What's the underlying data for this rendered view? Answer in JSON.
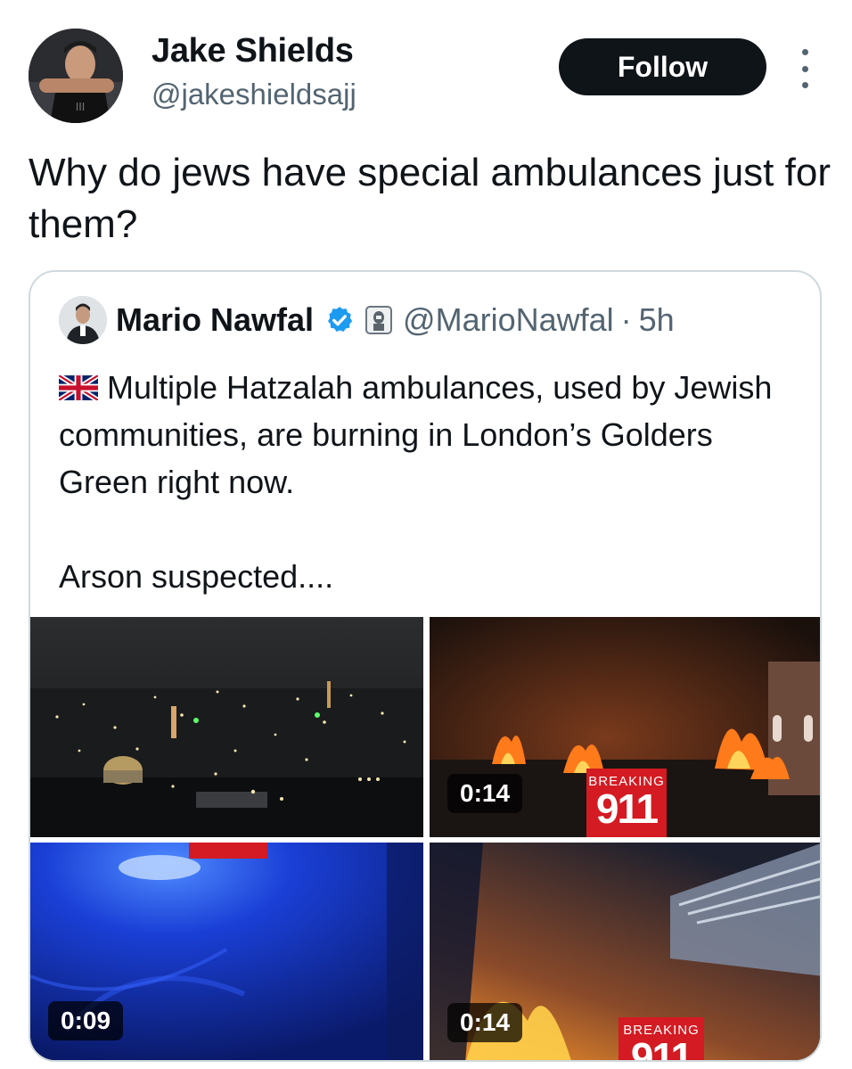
{
  "author": {
    "name": "Jake Shields",
    "handle": "@jakeshieldsajj",
    "avatar_icon": "profile-photo"
  },
  "actions": {
    "follow_label": "Follow",
    "more_icon": "more-dots-vertical-icon"
  },
  "tweet": {
    "text": "Why do jews have special ambulances just for them?"
  },
  "quoted": {
    "name": "Mario Nawfal",
    "verified_icon": "verified-badge-icon",
    "affiliate_icon": "affiliate-badge-icon",
    "handle": "@MarioNawfal",
    "separator": "·",
    "time": "5h",
    "flag_icon": "uk-flag-icon",
    "paragraph1": "Multiple Hatzalah ambulances, used by Jewish communities, are burning in London’s Golders Green right now.",
    "paragraph2": "Arson suspected...."
  },
  "media": [
    {
      "duration": "",
      "icon": "night-city-thumbnail"
    },
    {
      "duration": "0:14",
      "icon": "fire-thumbnail",
      "overlay_top": "BREAKING",
      "overlay_num": "911"
    },
    {
      "duration": "0:09",
      "icon": "blue-light-thumbnail"
    },
    {
      "duration": "0:14",
      "icon": "fire-thumbnail",
      "overlay_top": "BREAKING",
      "overlay_num": "911"
    }
  ],
  "colors": {
    "text": "#0f1419",
    "secondary": "#536471",
    "border": "#cfd9de",
    "verified": "#1d9bf0",
    "breaking_red": "#d41a22"
  }
}
